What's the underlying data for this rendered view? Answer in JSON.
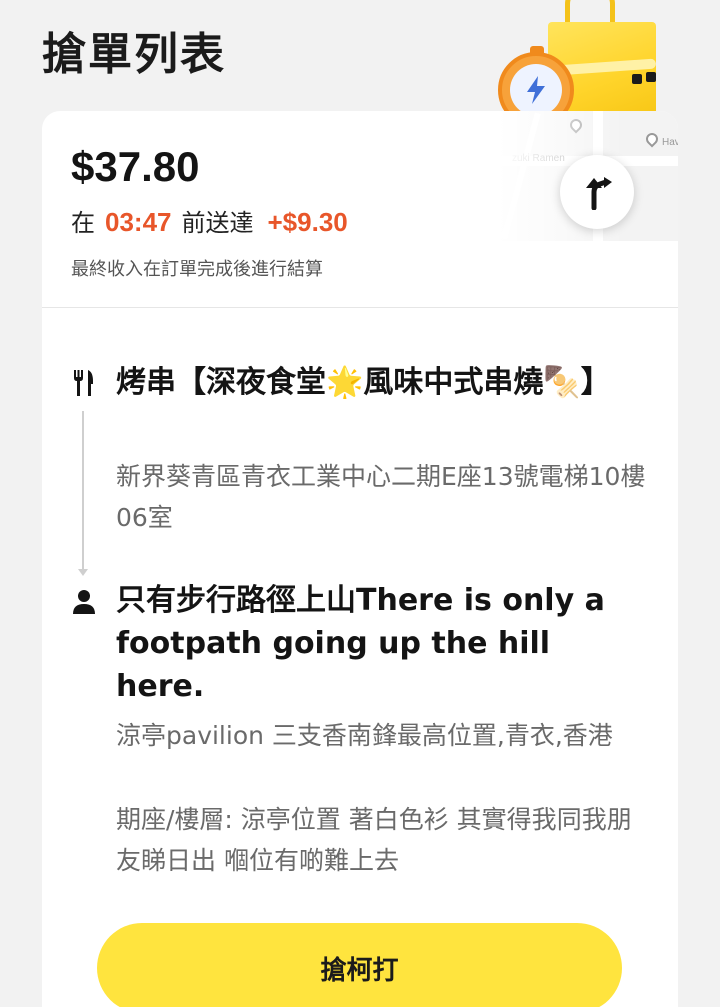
{
  "header": {
    "title": "搶單列表"
  },
  "order": {
    "price": "$37.80",
    "deliver_prefix": "在",
    "deliver_time": "03:47",
    "deliver_suffix": "前送達",
    "bonus": "+$9.30",
    "note": "最終收入在訂單完成後進行結算"
  },
  "map": {
    "label_1": "zuki Ramen",
    "label_2": "Hav"
  },
  "pickup": {
    "icon": "utensils-icon",
    "name": "烤串【深夜食堂🌟風味中式串燒🍢】",
    "address": "新界葵青區青衣工業中心二期E座13號電梯10樓06室"
  },
  "dropoff": {
    "icon": "person-icon",
    "name": "只有步行路徑上山There is only a footpath going up the hill here.",
    "address": "涼亭pavilion  三支香南鋒最高位置,青衣,香港",
    "detail": "期座/樓層: 涼亭位置 著白色衫 其實得我同我朋友睇日出 嗰位有啲難上去"
  },
  "action": {
    "grab_label": "搶柯打"
  },
  "colors": {
    "accent": "#e8562a",
    "button": "#ffe43e"
  }
}
